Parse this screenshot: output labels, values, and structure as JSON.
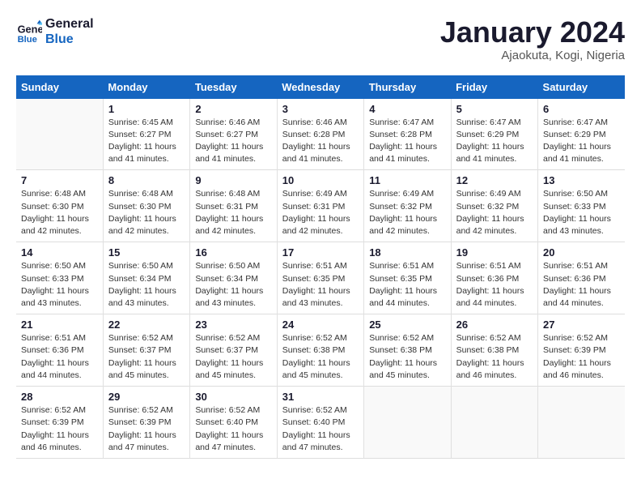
{
  "header": {
    "logo_line1": "General",
    "logo_line2": "Blue",
    "title": "January 2024",
    "subtitle": "Ajaokuta, Kogi, Nigeria"
  },
  "days_of_week": [
    "Sunday",
    "Monday",
    "Tuesday",
    "Wednesday",
    "Thursday",
    "Friday",
    "Saturday"
  ],
  "weeks": [
    [
      {
        "day": "",
        "info": ""
      },
      {
        "day": "1",
        "info": "Sunrise: 6:45 AM\nSunset: 6:27 PM\nDaylight: 11 hours\nand 41 minutes."
      },
      {
        "day": "2",
        "info": "Sunrise: 6:46 AM\nSunset: 6:27 PM\nDaylight: 11 hours\nand 41 minutes."
      },
      {
        "day": "3",
        "info": "Sunrise: 6:46 AM\nSunset: 6:28 PM\nDaylight: 11 hours\nand 41 minutes."
      },
      {
        "day": "4",
        "info": "Sunrise: 6:47 AM\nSunset: 6:28 PM\nDaylight: 11 hours\nand 41 minutes."
      },
      {
        "day": "5",
        "info": "Sunrise: 6:47 AM\nSunset: 6:29 PM\nDaylight: 11 hours\nand 41 minutes."
      },
      {
        "day": "6",
        "info": "Sunrise: 6:47 AM\nSunset: 6:29 PM\nDaylight: 11 hours\nand 41 minutes."
      }
    ],
    [
      {
        "day": "7",
        "info": "Sunrise: 6:48 AM\nSunset: 6:30 PM\nDaylight: 11 hours\nand 42 minutes."
      },
      {
        "day": "8",
        "info": "Sunrise: 6:48 AM\nSunset: 6:30 PM\nDaylight: 11 hours\nand 42 minutes."
      },
      {
        "day": "9",
        "info": "Sunrise: 6:48 AM\nSunset: 6:31 PM\nDaylight: 11 hours\nand 42 minutes."
      },
      {
        "day": "10",
        "info": "Sunrise: 6:49 AM\nSunset: 6:31 PM\nDaylight: 11 hours\nand 42 minutes."
      },
      {
        "day": "11",
        "info": "Sunrise: 6:49 AM\nSunset: 6:32 PM\nDaylight: 11 hours\nand 42 minutes."
      },
      {
        "day": "12",
        "info": "Sunrise: 6:49 AM\nSunset: 6:32 PM\nDaylight: 11 hours\nand 42 minutes."
      },
      {
        "day": "13",
        "info": "Sunrise: 6:50 AM\nSunset: 6:33 PM\nDaylight: 11 hours\nand 43 minutes."
      }
    ],
    [
      {
        "day": "14",
        "info": "Sunrise: 6:50 AM\nSunset: 6:33 PM\nDaylight: 11 hours\nand 43 minutes."
      },
      {
        "day": "15",
        "info": "Sunrise: 6:50 AM\nSunset: 6:34 PM\nDaylight: 11 hours\nand 43 minutes."
      },
      {
        "day": "16",
        "info": "Sunrise: 6:50 AM\nSunset: 6:34 PM\nDaylight: 11 hours\nand 43 minutes."
      },
      {
        "day": "17",
        "info": "Sunrise: 6:51 AM\nSunset: 6:35 PM\nDaylight: 11 hours\nand 43 minutes."
      },
      {
        "day": "18",
        "info": "Sunrise: 6:51 AM\nSunset: 6:35 PM\nDaylight: 11 hours\nand 44 minutes."
      },
      {
        "day": "19",
        "info": "Sunrise: 6:51 AM\nSunset: 6:36 PM\nDaylight: 11 hours\nand 44 minutes."
      },
      {
        "day": "20",
        "info": "Sunrise: 6:51 AM\nSunset: 6:36 PM\nDaylight: 11 hours\nand 44 minutes."
      }
    ],
    [
      {
        "day": "21",
        "info": "Sunrise: 6:51 AM\nSunset: 6:36 PM\nDaylight: 11 hours\nand 44 minutes."
      },
      {
        "day": "22",
        "info": "Sunrise: 6:52 AM\nSunset: 6:37 PM\nDaylight: 11 hours\nand 45 minutes."
      },
      {
        "day": "23",
        "info": "Sunrise: 6:52 AM\nSunset: 6:37 PM\nDaylight: 11 hours\nand 45 minutes."
      },
      {
        "day": "24",
        "info": "Sunrise: 6:52 AM\nSunset: 6:38 PM\nDaylight: 11 hours\nand 45 minutes."
      },
      {
        "day": "25",
        "info": "Sunrise: 6:52 AM\nSunset: 6:38 PM\nDaylight: 11 hours\nand 45 minutes."
      },
      {
        "day": "26",
        "info": "Sunrise: 6:52 AM\nSunset: 6:38 PM\nDaylight: 11 hours\nand 46 minutes."
      },
      {
        "day": "27",
        "info": "Sunrise: 6:52 AM\nSunset: 6:39 PM\nDaylight: 11 hours\nand 46 minutes."
      }
    ],
    [
      {
        "day": "28",
        "info": "Sunrise: 6:52 AM\nSunset: 6:39 PM\nDaylight: 11 hours\nand 46 minutes."
      },
      {
        "day": "29",
        "info": "Sunrise: 6:52 AM\nSunset: 6:39 PM\nDaylight: 11 hours\nand 47 minutes."
      },
      {
        "day": "30",
        "info": "Sunrise: 6:52 AM\nSunset: 6:40 PM\nDaylight: 11 hours\nand 47 minutes."
      },
      {
        "day": "31",
        "info": "Sunrise: 6:52 AM\nSunset: 6:40 PM\nDaylight: 11 hours\nand 47 minutes."
      },
      {
        "day": "",
        "info": ""
      },
      {
        "day": "",
        "info": ""
      },
      {
        "day": "",
        "info": ""
      }
    ]
  ]
}
